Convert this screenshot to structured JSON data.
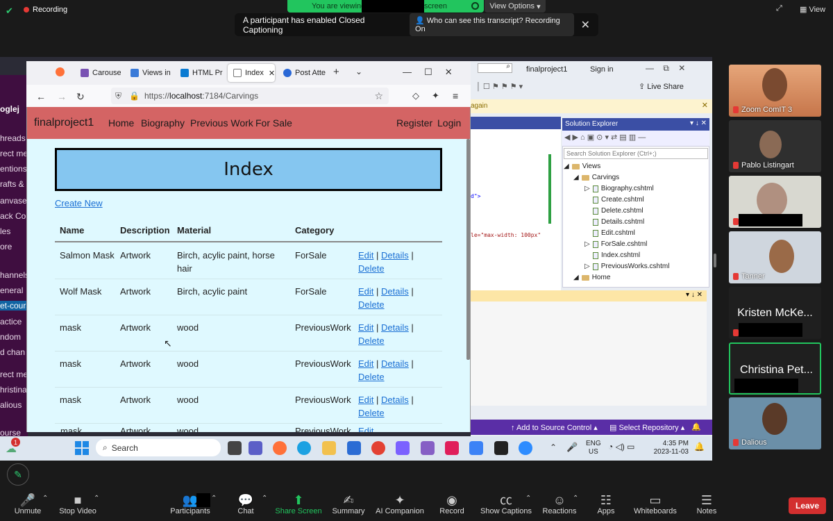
{
  "zoom": {
    "recording": "Recording",
    "viewing_prefix": "You are viewing",
    "viewing_suffix": "screen",
    "view_options": "View Options",
    "view": "View",
    "cc_message": "A participant has enabled Closed Captioning",
    "cc_who": "Who can see this transcript? Recording On",
    "participants": [
      {
        "name": "Zoom ComIT 3"
      },
      {
        "name": "Pablo Listingart"
      },
      {
        "name": ""
      },
      {
        "name": "Tanner"
      },
      {
        "name": "Kristen McKe..."
      },
      {
        "name": "Christina Pet..."
      },
      {
        "name": "Dalious"
      }
    ],
    "toolbar": [
      "Unmute",
      "Stop Video",
      "Participants",
      "Chat",
      "Share Screen",
      "Summary",
      "AI Companion",
      "Record",
      "Show Captions",
      "Reactions",
      "Apps",
      "Whiteboards",
      "Notes"
    ],
    "leave": "Leave"
  },
  "browser": {
    "tabs": [
      "Carousel",
      "Views in",
      "HTML Pr",
      "Index",
      "Post Atte"
    ],
    "url_prefix": "https://",
    "url_host": "localhost",
    "url_rest": ":7184/Carvings"
  },
  "site": {
    "brand": "finalproject1",
    "nav": [
      "Home",
      "Biography",
      "Previous Work",
      "For Sale"
    ],
    "nav_right": [
      "Register",
      "Login"
    ],
    "heading": "Index",
    "create_new": "Create New",
    "columns": [
      "Name",
      "Description",
      "Material",
      "Category"
    ],
    "rows": [
      {
        "name": "Salmon Mask",
        "description": "Artwork",
        "material": "Birch, acylic paint, horse hair",
        "category": "ForSale"
      },
      {
        "name": "Wolf Mask",
        "description": "Artwork",
        "material": "Birch, acylic paint",
        "category": "ForSale"
      },
      {
        "name": "mask",
        "description": "Artwork",
        "material": "wood",
        "category": "PreviousWork"
      },
      {
        "name": "mask",
        "description": "Artwork",
        "material": "wood",
        "category": "PreviousWork"
      },
      {
        "name": "mask",
        "description": "Artwork",
        "material": "wood",
        "category": "PreviousWork"
      }
    ],
    "links": {
      "edit": "Edit",
      "details": "Details",
      "delete": "Delete",
      "sep": "|"
    }
  },
  "vs": {
    "title": "finalproject1",
    "signin": "Sign in",
    "live_share": "Live Share",
    "again": "again",
    "solution_explorer": "Solution Explorer",
    "search_placeholder": "Search Solution Explorer (Ctrl+;)",
    "code1": "d\">",
    "code2": "le=\"max-width: 100px\"",
    "tree": [
      "Views",
      "Carvings",
      "Biography.cshtml",
      "Create.cshtml",
      "Delete.cshtml",
      "Details.cshtml",
      "Edit.cshtml",
      "ForSale.cshtml",
      "Index.cshtml",
      "PreviousWorks.cshtml",
      "Home"
    ],
    "add_source": "Add to Source Control",
    "select_repo": "Select Repository"
  },
  "slack": [
    "oglej",
    "hreads",
    "rect me",
    "entions",
    "rafts & s",
    "anvases",
    "ack Con",
    "les",
    "ore",
    "hannels",
    "eneral",
    "et-cours",
    "actice",
    "ndom",
    "d chan",
    "rect me",
    "hristina",
    "alious",
    "ourse"
  ],
  "taskbar": {
    "search": "Search",
    "lang1": "ENG",
    "lang2": "US",
    "time": "4:35 PM",
    "date": "2023-11-03",
    "badge": "1"
  }
}
